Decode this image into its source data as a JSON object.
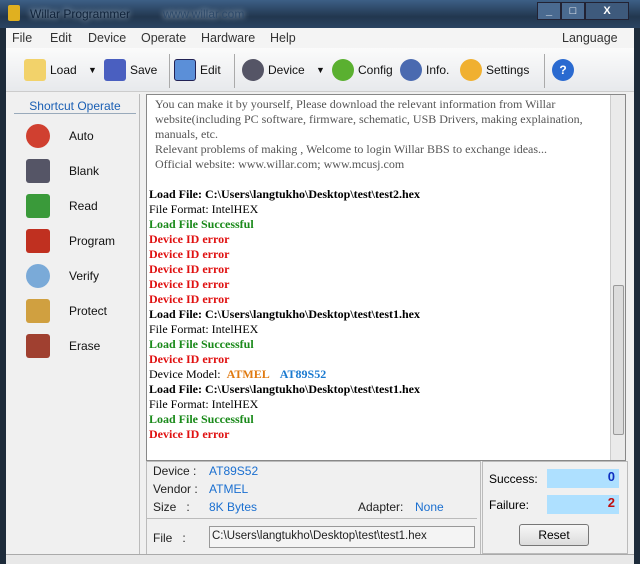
{
  "window": {
    "title": "Willar Programmer",
    "url": "www.willar.com",
    "min": "_",
    "max": "□",
    "close": "X"
  },
  "menu": [
    "File",
    "Edit",
    "Device",
    "Operate",
    "Hardware",
    "Help"
  ],
  "menu_right": "Language",
  "toolbar": {
    "load": "Load",
    "save": "Save",
    "edit": "Edit",
    "device": "Device",
    "config": "Config",
    "info": "Info.",
    "settings": "Settings",
    "dropdown": "▼",
    "help": "?"
  },
  "sidebar": {
    "header": "Shortcut Operate",
    "items": [
      "Auto",
      "Blank",
      "Read",
      "Program",
      "Verify",
      "Protect",
      "Erase"
    ]
  },
  "log": {
    "intro": [
      "You can make it by yourself, Please download the relevant information from Willar",
      "website(including PC software, firmware, schematic, USB Drivers, making explaination,",
      "manuals, etc.",
      "Relevant problems of making , Welcome to login Willar BBS to exchange ideas...",
      "Official website: www.willar.com; www.mcusj.com"
    ],
    "lines": [
      {
        "t": "Load File: C:\\Users\\langtukho\\Desktop\\test\\test2.hex",
        "c": "#000",
        "b": true
      },
      {
        "t": "File Format: IntelHEX",
        "c": "#000",
        "b": false
      },
      {
        "t": "Load File Successful",
        "c": "#1a8a1a",
        "b": true
      },
      {
        "t": "Device ID error",
        "c": "#e01010",
        "b": true
      },
      {
        "t": "Device ID error",
        "c": "#e01010",
        "b": true
      },
      {
        "t": "Device ID error",
        "c": "#e01010",
        "b": true
      },
      {
        "t": "Device ID error",
        "c": "#e01010",
        "b": true
      },
      {
        "t": "Device ID error",
        "c": "#e01010",
        "b": true
      },
      {
        "t": "Load File: C:\\Users\\langtukho\\Desktop\\test\\test1.hex",
        "c": "#000",
        "b": true
      },
      {
        "t": "File Format: IntelHEX",
        "c": "#000",
        "b": false
      },
      {
        "t": "Load File Successful",
        "c": "#1a8a1a",
        "b": true
      },
      {
        "t": "Device ID error",
        "c": "#e01010",
        "b": true
      },
      {
        "t": "Device Model:",
        "c": "#000",
        "b": false,
        "v": "ATMEL",
        "m": "AT89S52"
      },
      {
        "t": "Load File: C:\\Users\\langtukho\\Desktop\\test\\test1.hex",
        "c": "#000",
        "b": true
      },
      {
        "t": "File Format: IntelHEX",
        "c": "#000",
        "b": false
      },
      {
        "t": "Load File Successful",
        "c": "#1a8a1a",
        "b": true
      },
      {
        "t": "Device ID error",
        "c": "#e01010",
        "b": true
      }
    ]
  },
  "info": {
    "device_label": "Device :",
    "device": "AT89S52",
    "vendor_label": "Vendor :",
    "vendor": "ATMEL",
    "size_label": "Size   :",
    "size": "8K Bytes",
    "adapter_label": "Adapter:",
    "adapter": "None",
    "file_label": "File   :",
    "file": "C:\\Users\\langtukho\\Desktop\\test\\test1.hex"
  },
  "stats": {
    "success_label": "Success:",
    "success": "0",
    "failure_label": "Failure:",
    "failure": "2",
    "reset": "Reset"
  }
}
